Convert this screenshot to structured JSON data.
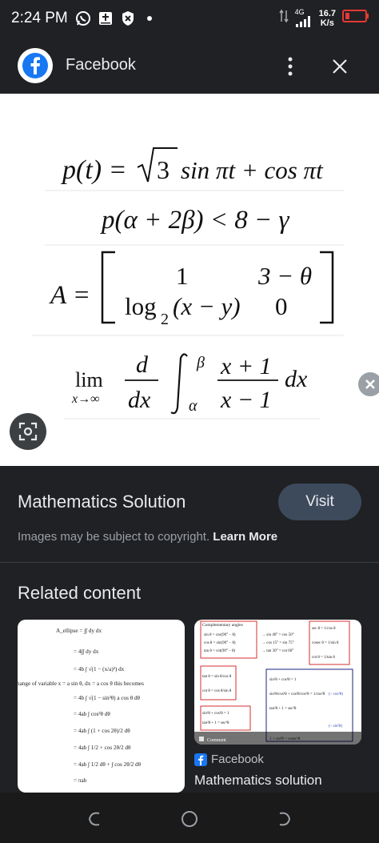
{
  "status_bar": {
    "time": "2:24 PM",
    "network": "4G",
    "speed_value": "16.7",
    "speed_unit": "K/s"
  },
  "app_bar": {
    "title": "Facebook",
    "icons": [
      "facebook-logo",
      "more-vert-icon",
      "close-icon"
    ]
  },
  "formulas": {
    "f1": {
      "lhs": "p(t) =",
      "n3": "3",
      "rhs": "sin πt + cos πt"
    },
    "f2": {
      "text": "p(α + 2β) < 8 − γ"
    },
    "f3": {
      "lhs": "A =",
      "r1c1": "1",
      "r1c2": "3 − θ",
      "r2c1": "log",
      "r2c1_sub": "2",
      "r2c1_arg": "(x − y)",
      "r2c2": "0"
    },
    "f4": {
      "lim": "lim",
      "lim_sub": "x→∞",
      "d_num": "d",
      "d_den": "dx",
      "int_upper": "β",
      "int_lower": "α",
      "frac_num": "x + 1",
      "frac_den": "x − 1",
      "dx": "dx"
    }
  },
  "info": {
    "title": "Mathematics Solution",
    "visit_label": "Visit",
    "copyright_text": "Images may be subject to copyright.",
    "learn_more": "Learn More"
  },
  "related": {
    "title": "Related content",
    "card1": {
      "lines": [
        "A_ellipse = ∫∫ dy dx",
        "= 4∫∫ dy dx",
        "= 4b ∫ √(1 − (x/a)²) dx",
        "hange of variable  x = a sin θ, dx = a cos θ this becomes",
        "= 4b ∫ √(1 − sin²θ) a cos θ dθ",
        "= 4ab ∫ cos²θ dθ",
        "= 4ab ∫ (1 + cos 2θ)/2 dθ",
        "= 4ab ∫ 1/2 + cos 2θ/2 dθ",
        "= 4ab ∫ 1/2 dθ + ∫ cos 2θ/2 dθ",
        "= πab"
      ]
    },
    "card2": {
      "header": "Complementary angles",
      "source": "Facebook",
      "title": "Mathematics solution",
      "left_rows": [
        "sin θ = cos(90° − θ)",
        "cos θ = sin(90° − θ)",
        "tan θ = cot(90° − θ)"
      ],
      "mid_rows": [
        "→ sin 40° = cos 50°",
        "→ cos 15° = sin 75°",
        "→ tan 30° = cot 60°"
      ],
      "right_rows": [
        "sec θ = 1/cos θ",
        "cosec θ = 1/sin θ",
        "cot θ = 1/tan θ"
      ],
      "quot_rows": [
        "tan θ = sin θ/cos θ",
        "cot θ = cos θ/sin θ"
      ],
      "pyth_rows": [
        "sin²θ + cos²θ = 1",
        "tan²θ + 1 = sec²θ"
      ],
      "blue_rows": [
        "sin²θ + cos²θ = 1",
        "sin²θ/cos²θ + cos²θ/cos²θ = 1/cos²θ",
        "tan²θ + 1 = sec²θ"
      ],
      "cos_note": "(÷ cos²θ)",
      "sin_note": "(÷ sin²θ)",
      "bottom_row": "1 + cot²θ = cosec²θ",
      "overlay_comment": "Comment"
    }
  }
}
